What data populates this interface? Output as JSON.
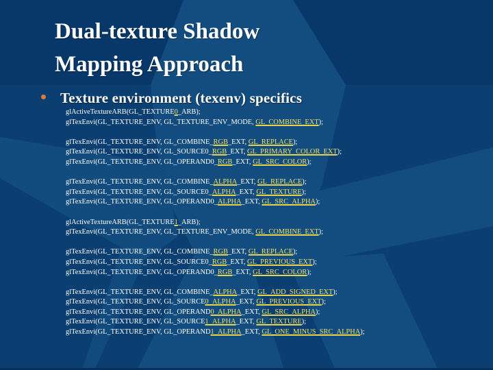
{
  "slide": {
    "title_line1": "Dual-texture Shadow",
    "title_line2": "Mapping Approach",
    "bullet_icon": "orange-dot-bullet",
    "bullet_text": "Texture environment (texenv) specifics",
    "colors": {
      "background": "#073869",
      "background_rays": "#134d7f",
      "title": "#ffffff",
      "bullet": "#e07a36",
      "highlight": "#f0e068"
    }
  },
  "code_groups": [
    [
      [
        {
          "t": "glActiveTextureARB(GL_TEXTURE"
        },
        {
          "t": "0",
          "hl": true
        },
        {
          "t": "_ARB);"
        }
      ],
      [
        {
          "t": "glTexEnvi(GL_TEXTURE_ENV, GL_TEXTURE_ENV_MODE, "
        },
        {
          "t": "GL_COMBINE_EXT",
          "hl": true
        },
        {
          "t": ");"
        }
      ]
    ],
    [
      [
        {
          "t": "glTexEnvi(GL_TEXTURE_ENV, GL_COMBINE_"
        },
        {
          "t": "RGB",
          "hl": true
        },
        {
          "t": "_EXT, "
        },
        {
          "t": "GL_REPLACE",
          "hl": true
        },
        {
          "t": ");"
        }
      ],
      [
        {
          "t": "glTexEnvi(GL_TEXTURE_ENV, GL_SOURCE0_"
        },
        {
          "t": "RGB",
          "hl": true
        },
        {
          "t": "_EXT, "
        },
        {
          "t": "GL_PRIMARY_COLOR_EXT",
          "hl": true
        },
        {
          "t": ");"
        }
      ],
      [
        {
          "t": "glTexEnvi(GL_TEXTURE_ENV, GL_OPERAND0_"
        },
        {
          "t": "RGB",
          "hl": true
        },
        {
          "t": "_EXT, "
        },
        {
          "t": "GL_SRC_COLOR",
          "hl": true
        },
        {
          "t": ");"
        }
      ]
    ],
    [
      [
        {
          "t": "glTexEnvi(GL_TEXTURE_ENV, GL_COMBINE_"
        },
        {
          "t": "ALPHA",
          "hl": true
        },
        {
          "t": "_EXT, "
        },
        {
          "t": "GL_REPLACE",
          "hl": true
        },
        {
          "t": ");"
        }
      ],
      [
        {
          "t": "glTexEnvi(GL_TEXTURE_ENV, GL_SOURCE0_"
        },
        {
          "t": "ALPHA",
          "hl": true
        },
        {
          "t": "_EXT, "
        },
        {
          "t": "GL_TEXTURE",
          "hl": true
        },
        {
          "t": ");"
        }
      ],
      [
        {
          "t": "glTexEnvi(GL_TEXTURE_ENV, GL_OPERAND0_"
        },
        {
          "t": "ALPHA",
          "hl": true
        },
        {
          "t": "_EXT, "
        },
        {
          "t": "GL_SRC_ALPHA",
          "hl": true
        },
        {
          "t": ");"
        }
      ]
    ],
    [
      [
        {
          "t": "glActiveTextureARB(GL_TEXTURE"
        },
        {
          "t": "1",
          "hl": true
        },
        {
          "t": "_ARB);"
        }
      ],
      [
        {
          "t": "glTexEnvi(GL_TEXTURE_ENV, GL_TEXTURE_ENV_MODE, "
        },
        {
          "t": "GL_COMBINE_EXT",
          "hl": true
        },
        {
          "t": ");"
        }
      ]
    ],
    [
      [
        {
          "t": "glTexEnvi(GL_TEXTURE_ENV, GL_COMBINE_"
        },
        {
          "t": "RGB",
          "hl": true
        },
        {
          "t": "_EXT, "
        },
        {
          "t": "GL_REPLACE",
          "hl": true
        },
        {
          "t": ");"
        }
      ],
      [
        {
          "t": "glTexEnvi(GL_TEXTURE_ENV, GL_SOURCE0_"
        },
        {
          "t": "RGB",
          "hl": true
        },
        {
          "t": "_EXT, "
        },
        {
          "t": "GL_PREVIOUS_EXT",
          "hl": true
        },
        {
          "t": ");"
        }
      ],
      [
        {
          "t": "glTexEnvi(GL_TEXTURE_ENV, GL_OPERAND0_"
        },
        {
          "t": "RGB",
          "hl": true
        },
        {
          "t": "_EXT, "
        },
        {
          "t": "GL_SRC_COLOR",
          "hl": true
        },
        {
          "t": ");"
        }
      ]
    ],
    [
      [
        {
          "t": "glTexEnvi(GL_TEXTURE_ENV, GL_COMBINE_"
        },
        {
          "t": "ALPHA",
          "hl": true
        },
        {
          "t": "_EXT, "
        },
        {
          "t": "GL_ADD_SIGNED_EXT",
          "hl": true
        },
        {
          "t": ");"
        }
      ],
      [
        {
          "t": "glTexEnvi(GL_TEXTURE_ENV, GL_SOURCE"
        },
        {
          "t": "0_ALPHA",
          "hl": true
        },
        {
          "t": "_EXT, "
        },
        {
          "t": "GL_PREVIOUS_EXT",
          "hl": true
        },
        {
          "t": ");"
        }
      ],
      [
        {
          "t": "glTexEnvi(GL_TEXTURE_ENV, GL_OPERAND"
        },
        {
          "t": "0_ALPHA",
          "hl": true
        },
        {
          "t": "_EXT, "
        },
        {
          "t": "GL_SRC_ALPHA",
          "hl": true
        },
        {
          "t": ");"
        }
      ],
      [
        {
          "t": "glTexEnvi(GL_TEXTURE_ENV, GL_SOURCE"
        },
        {
          "t": "1_ALPHA",
          "hl": true
        },
        {
          "t": "_EXT, "
        },
        {
          "t": "GL_TEXTURE",
          "hl": true
        },
        {
          "t": ");"
        }
      ],
      [
        {
          "t": "glTexEnvi(GL_TEXTURE_ENV, GL_OPERAND"
        },
        {
          "t": "1_ALPHA",
          "hl": true
        },
        {
          "t": "_EXT, "
        },
        {
          "t": "GL_ONE_MINUS_SRC_ALPHA",
          "hl": true
        },
        {
          "t": ");"
        }
      ]
    ]
  ]
}
